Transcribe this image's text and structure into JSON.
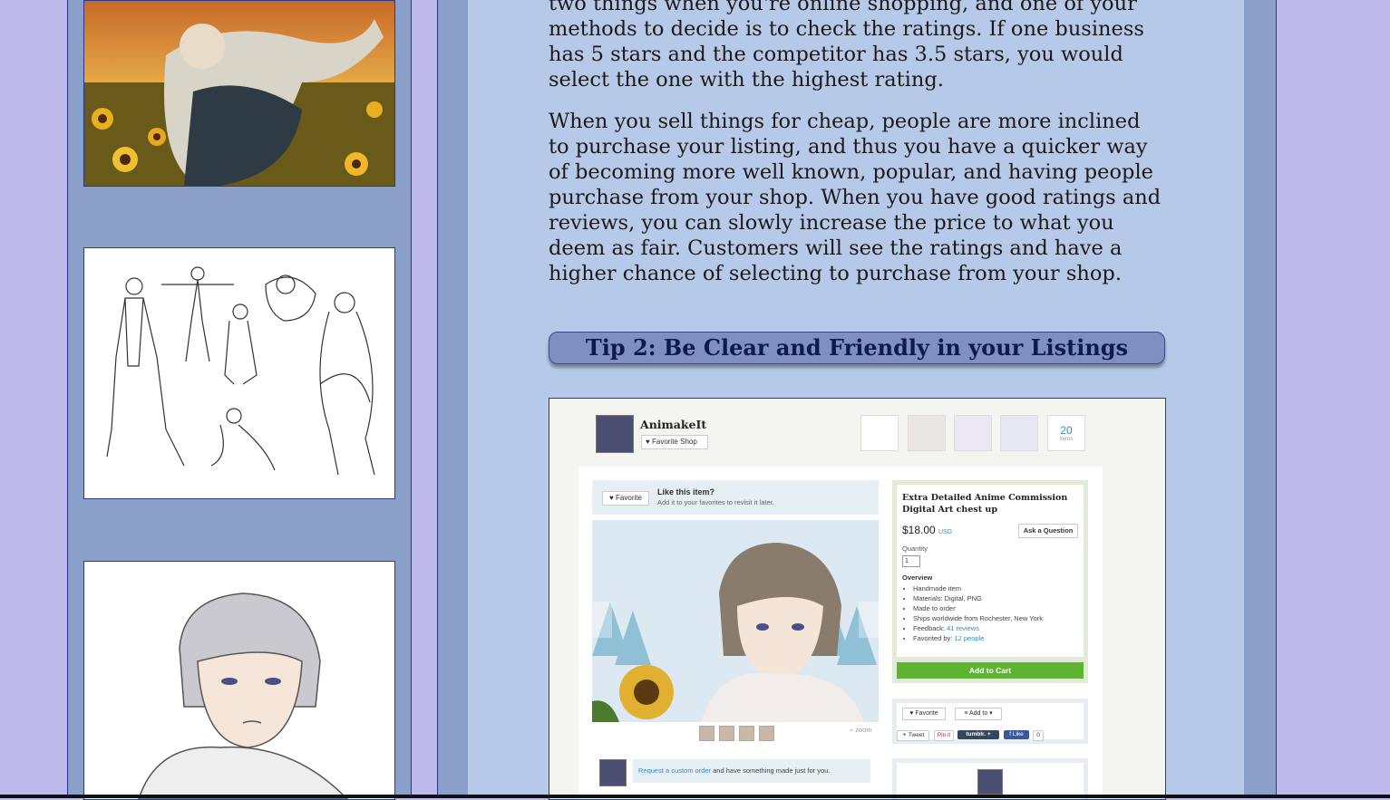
{
  "article": {
    "paragraph_1": "two things when you're online shopping, and one of your methods to decide is to check the ratings. If one business has 5 stars and the competitor has 3.5 stars, you would select the one with the highest rating.",
    "paragraph_2": "When you sell things for cheap, people are more inclined to purchase your listing, and thus you have a quicker way of becoming more well known, popular, and having people purchase from your shop. When you have good ratings and reviews, you can slowly increase the price to what you deem as fair. Customers will see the ratings and have a higher chance of selecting to purchase from your shop.",
    "tip_heading": "Tip 2: Be Clear and Friendly in your Listings"
  },
  "listing_screenshot": {
    "shop_name": "AnimakeIt",
    "favorite_shop": "Favorite Shop",
    "items_count": "20",
    "items_label": "items",
    "favorite_btn": "Favorite",
    "like_title": "Like this item?",
    "like_sub": "Add it to your favorites to revisit it later.",
    "zoom": "zoom",
    "title": "Extra Detailed Anime Commission Digital Art chest up",
    "price": "$18.00",
    "currency": "USD",
    "ask": "Ask a Question",
    "quantity_label": "Quantity",
    "quantity_value": "1",
    "overview": "Overview",
    "overview_items": {
      "handmade": "Handmade item",
      "materials": "Materials: Digital, PNG",
      "made": "Made to order",
      "ships": "Ships worldwide from Rochester, New York",
      "feedback_label": "Feedback:",
      "feedback_link": "41 reviews",
      "favorited_label": "Favorited by:",
      "favorited_link": "12 people"
    },
    "add_to_cart": "Add to Cart",
    "favorite_small": "Favorite",
    "add_to": "Add to",
    "tweet": "Tweet",
    "pin": "Pin it",
    "tumblr": "tumblr.",
    "fb_like": "Like",
    "fb_count": "0",
    "custom_link": "Request a custom order",
    "custom_rest": " and have something made just for you."
  },
  "colors": {
    "page_bg": "#bfb8ea",
    "column_bg": "#8aa0c9",
    "content_bg": "#b7c9e8",
    "heading_bg": "#7f8fc2",
    "heading_text": "#0c1a4e",
    "cart_green": "#5fb333",
    "link_blue": "#3a8bbf"
  }
}
